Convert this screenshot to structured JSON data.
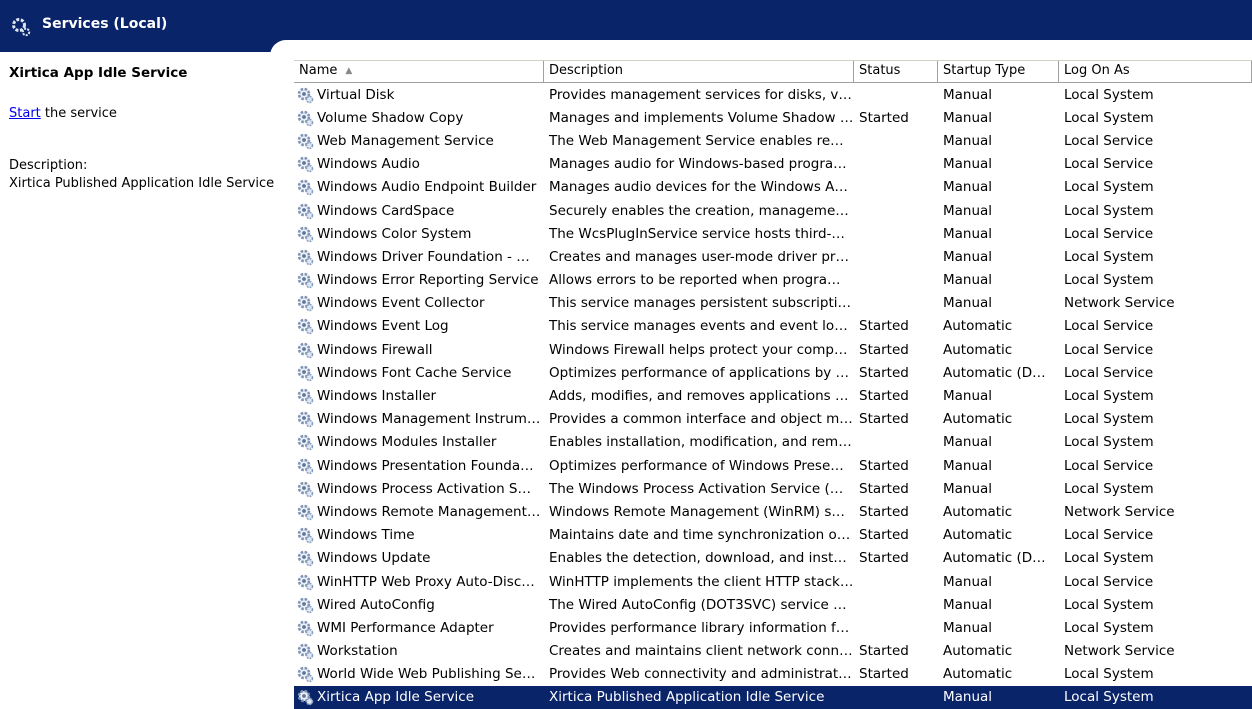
{
  "window": {
    "title": "Services (Local)"
  },
  "left_pane": {
    "service_title": "Xirtica App Idle Service",
    "start_link": "Start",
    "start_suffix": " the service",
    "description_label": "Description:",
    "description_text": "Xirtica Published Application Idle Service"
  },
  "columns": {
    "name": "Name",
    "description": "Description",
    "status": "Status",
    "startup_type": "Startup Type",
    "log_on_as": "Log On As"
  },
  "colors": {
    "header": "#0a246a",
    "selected": "#0a246a"
  },
  "icons": {
    "header": "services-gear-icon",
    "row": "service-gear-icon"
  },
  "rows": [
    {
      "name": "Virtual Disk",
      "description": "Provides management services for disks, v…",
      "status": "",
      "startup": "Manual",
      "logon": "Local System"
    },
    {
      "name": "Volume Shadow Copy",
      "description": "Manages and implements Volume Shadow …",
      "status": "Started",
      "startup": "Manual",
      "logon": "Local System"
    },
    {
      "name": "Web Management Service",
      "description": "The Web Management Service enables re…",
      "status": "",
      "startup": "Manual",
      "logon": "Local Service"
    },
    {
      "name": "Windows Audio",
      "description": "Manages audio for Windows-based progra…",
      "status": "",
      "startup": "Manual",
      "logon": "Local Service"
    },
    {
      "name": "Windows Audio Endpoint Builder",
      "description": "Manages audio devices for the Windows A…",
      "status": "",
      "startup": "Manual",
      "logon": "Local System"
    },
    {
      "name": "Windows CardSpace",
      "description": "Securely enables the creation, manageme…",
      "status": "",
      "startup": "Manual",
      "logon": "Local System"
    },
    {
      "name": "Windows Color System",
      "description": "The WcsPlugInService service hosts third-…",
      "status": "",
      "startup": "Manual",
      "logon": "Local Service"
    },
    {
      "name": "Windows Driver Foundation - …",
      "description": "Creates and manages user-mode driver pr…",
      "status": "",
      "startup": "Manual",
      "logon": "Local System"
    },
    {
      "name": "Windows Error Reporting Service",
      "description": "Allows errors to be reported when progra…",
      "status": "",
      "startup": "Manual",
      "logon": "Local System"
    },
    {
      "name": "Windows Event Collector",
      "description": "This service manages persistent subscripti…",
      "status": "",
      "startup": "Manual",
      "logon": "Network Service"
    },
    {
      "name": "Windows Event Log",
      "description": "This service manages events and event lo…",
      "status": "Started",
      "startup": "Automatic",
      "logon": "Local Service"
    },
    {
      "name": "Windows Firewall",
      "description": "Windows Firewall helps protect your comp…",
      "status": "Started",
      "startup": "Automatic",
      "logon": "Local Service"
    },
    {
      "name": "Windows Font Cache Service",
      "description": "Optimizes performance of applications by …",
      "status": "Started",
      "startup": "Automatic (D…",
      "logon": "Local Service"
    },
    {
      "name": "Windows Installer",
      "description": "Adds, modifies, and removes applications …",
      "status": "Started",
      "startup": "Manual",
      "logon": "Local System"
    },
    {
      "name": "Windows Management Instrum…",
      "description": "Provides a common interface and object m…",
      "status": "Started",
      "startup": "Automatic",
      "logon": "Local System"
    },
    {
      "name": "Windows Modules Installer",
      "description": "Enables installation, modification, and rem…",
      "status": "",
      "startup": "Manual",
      "logon": "Local System"
    },
    {
      "name": "Windows Presentation Founda…",
      "description": "Optimizes performance of Windows Prese…",
      "status": "Started",
      "startup": "Manual",
      "logon": "Local Service"
    },
    {
      "name": "Windows Process Activation S…",
      "description": "The Windows Process Activation Service (…",
      "status": "Started",
      "startup": "Manual",
      "logon": "Local System"
    },
    {
      "name": "Windows Remote Management…",
      "description": "Windows Remote Management (WinRM) s…",
      "status": "Started",
      "startup": "Automatic",
      "logon": "Network Service"
    },
    {
      "name": "Windows Time",
      "description": "Maintains date and time synchronization o…",
      "status": "Started",
      "startup": "Automatic",
      "logon": "Local Service"
    },
    {
      "name": "Windows Update",
      "description": "Enables the detection, download, and inst…",
      "status": "Started",
      "startup": "Automatic (D…",
      "logon": "Local System"
    },
    {
      "name": "WinHTTP Web Proxy Auto-Disc…",
      "description": "WinHTTP implements the client HTTP stack…",
      "status": "",
      "startup": "Manual",
      "logon": "Local Service"
    },
    {
      "name": "Wired AutoConfig",
      "description": "The Wired AutoConfig (DOT3SVC) service …",
      "status": "",
      "startup": "Manual",
      "logon": "Local System"
    },
    {
      "name": "WMI Performance Adapter",
      "description": "Provides performance library information f…",
      "status": "",
      "startup": "Manual",
      "logon": "Local System"
    },
    {
      "name": "Workstation",
      "description": "Creates and maintains client network conn…",
      "status": "Started",
      "startup": "Automatic",
      "logon": "Network Service"
    },
    {
      "name": "World Wide Web Publishing Se…",
      "description": "Provides Web connectivity and administrat…",
      "status": "Started",
      "startup": "Automatic",
      "logon": "Local System"
    },
    {
      "name": "Xirtica App Idle Service",
      "description": "Xirtica Published Application Idle Service",
      "status": "",
      "startup": "Manual",
      "logon": "Local System",
      "selected": true
    }
  ]
}
